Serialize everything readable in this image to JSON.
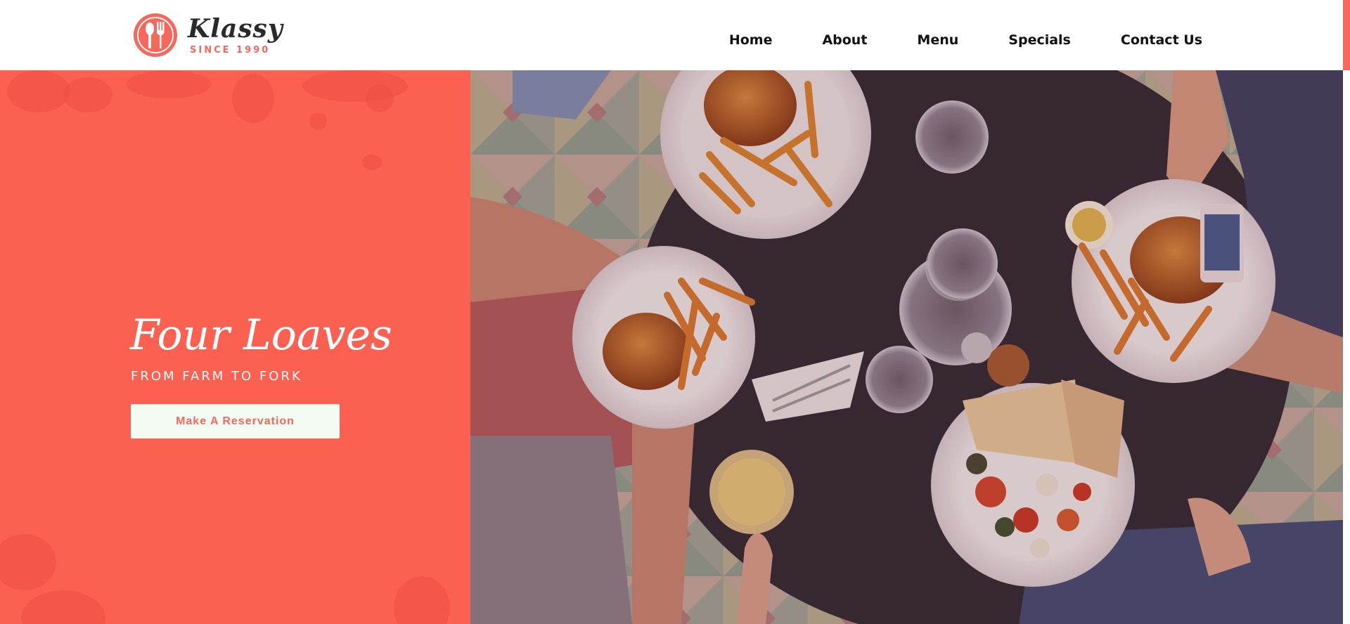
{
  "brand": {
    "name": "Klassy",
    "tagline": "SINCE 1990",
    "accent_color": "#f8675a"
  },
  "nav": {
    "items": [
      {
        "label": "Home"
      },
      {
        "label": "About"
      },
      {
        "label": "Menu"
      },
      {
        "label": "Specials"
      },
      {
        "label": "Contact Us"
      }
    ]
  },
  "hero": {
    "title": "Four Loaves",
    "subtitle": "FROM FARM TO FORK",
    "cta_label": "Make A Reservation",
    "background_color": "#fc6051",
    "image": {
      "content": "overhead-photo-of-friends-eating-burgers-fries-and-salad",
      "icon": "food-photo"
    }
  }
}
